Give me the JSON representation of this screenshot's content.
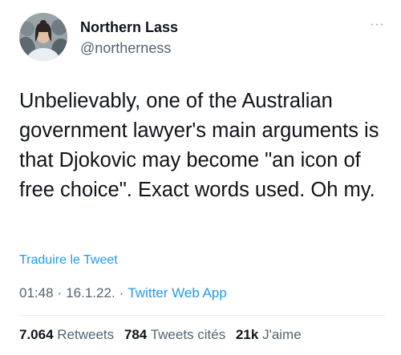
{
  "author": {
    "display_name": "Northern Lass",
    "handle": "@northerness",
    "avatar_icon": "profile-photo"
  },
  "more_icon": "ellipsis-icon",
  "more_label": "···",
  "tweet": {
    "text": "Unbelievably, one of the Australian government lawyer's main arguments is that Djokovic may become \"an icon of free choice\". Exact words used. Oh my."
  },
  "translate_label": "Traduire le Tweet",
  "meta": {
    "time": "01:48",
    "separator": "·",
    "date": "16.1.22.",
    "source": "Twitter Web App"
  },
  "stats": {
    "retweets_count": "7.064",
    "retweets_label": "Retweets",
    "quotes_count": "784",
    "quotes_label": "Tweets cités",
    "likes_count": "21k",
    "likes_label": "J'aime"
  },
  "colors": {
    "link": "#1d9bf0",
    "secondary_text": "#536471",
    "primary_text": "#0f1419"
  }
}
